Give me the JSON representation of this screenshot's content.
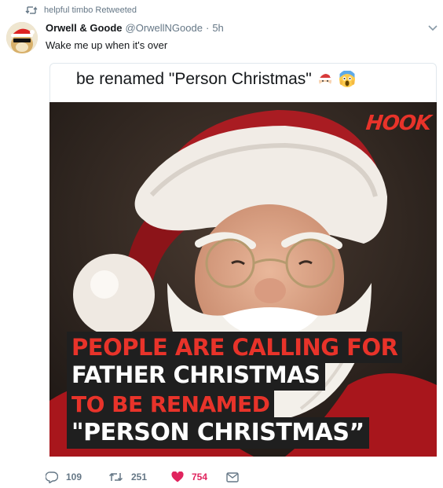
{
  "retweet_context": {
    "text": "helpful timbo Retweeted",
    "icon": "retweet-icon"
  },
  "tweet": {
    "author_name": "Orwell & Goode",
    "handle": "@OrwellNGoode",
    "separator": "·",
    "time": "5h",
    "text": "Wake me up when it's over",
    "avatar_icon": "doge-santa-avatar",
    "menu_icon": "chevron-down-icon"
  },
  "quoted": {
    "text": "be renamed \"Person Christmas\"",
    "emojis": [
      "santa-emoji",
      "scream-emoji"
    ]
  },
  "media": {
    "logo": "HOOK",
    "caption_lines": [
      "PEOPLE ARE CALLING FOR",
      "FATHER CHRISTMAS",
      "TO BE RENAMED",
      "\"PERSON CHRISTMAS”"
    ],
    "colors": {
      "red": "#e8332a",
      "white": "#ffffff",
      "caption_bg": "#1f1f1f"
    }
  },
  "actions": {
    "reply_count": "109",
    "retweet_count": "251",
    "like_count": "754",
    "like_color": "#e0245e",
    "icons": [
      "reply-icon",
      "retweet-icon",
      "heart-icon",
      "direct-message-icon"
    ]
  }
}
